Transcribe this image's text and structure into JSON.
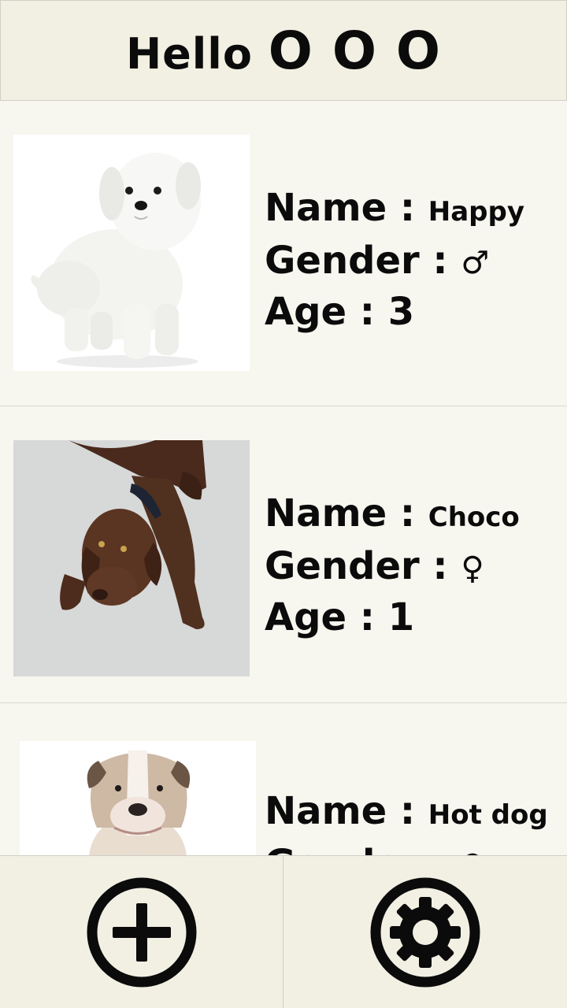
{
  "header": {
    "greeting": "Hello",
    "name_mask": "O O O"
  },
  "labels": {
    "name": "Name : ",
    "gender": "Gender : ",
    "age": "Age : "
  },
  "pets": [
    {
      "name": "Happy",
      "gender_symbol": "♂",
      "age": "3"
    },
    {
      "name": "Choco",
      "gender_symbol": "♀",
      "age": "1"
    },
    {
      "name": "Hot dog",
      "gender_symbol": "♀",
      "age": ""
    }
  ],
  "bottom_bar": {
    "add_icon": "add-circle-icon",
    "settings_icon": "gear-icon"
  },
  "colors": {
    "background": "#f7f6ef",
    "bar": "#f1f0e3",
    "text": "#0b0b0b"
  }
}
